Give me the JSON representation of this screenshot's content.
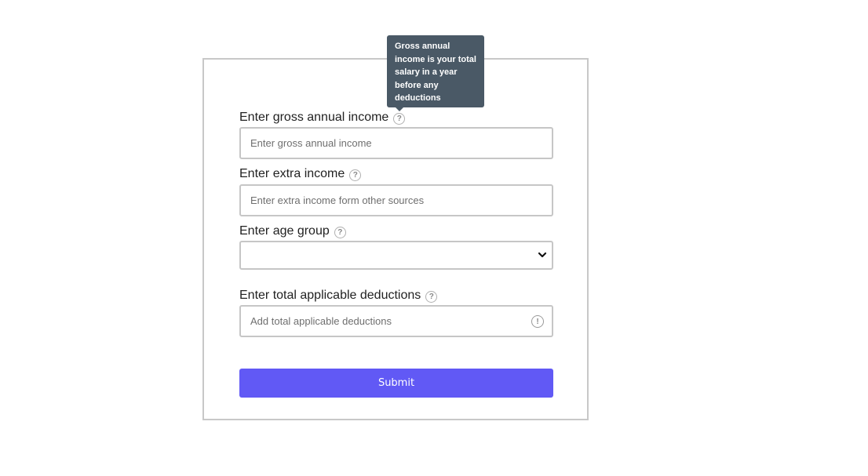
{
  "form": {
    "gross_income": {
      "label": "Enter gross annual income",
      "placeholder": "Enter gross annual income",
      "help": "?"
    },
    "extra_income": {
      "label": "Enter extra income",
      "placeholder": "Enter extra income form other sources",
      "help": "?"
    },
    "age_group": {
      "label": "Enter age group",
      "selected": "",
      "help": "?"
    },
    "deductions": {
      "label": "Enter total applicable deductions",
      "placeholder": "Add total applicable deductions",
      "help": "?",
      "alert": "!"
    },
    "submit_label": "Submit"
  },
  "tooltip": {
    "text": "Gross annual income is your total salary in a year before any deductions"
  },
  "colors": {
    "submit_bg": "#6159f5",
    "tooltip_bg": "#4a5966",
    "border": "#c6c6c6"
  },
  "icons": {
    "help": "question-circle-icon",
    "alert": "exclamation-circle-icon",
    "select": "chevron-down-icon"
  }
}
